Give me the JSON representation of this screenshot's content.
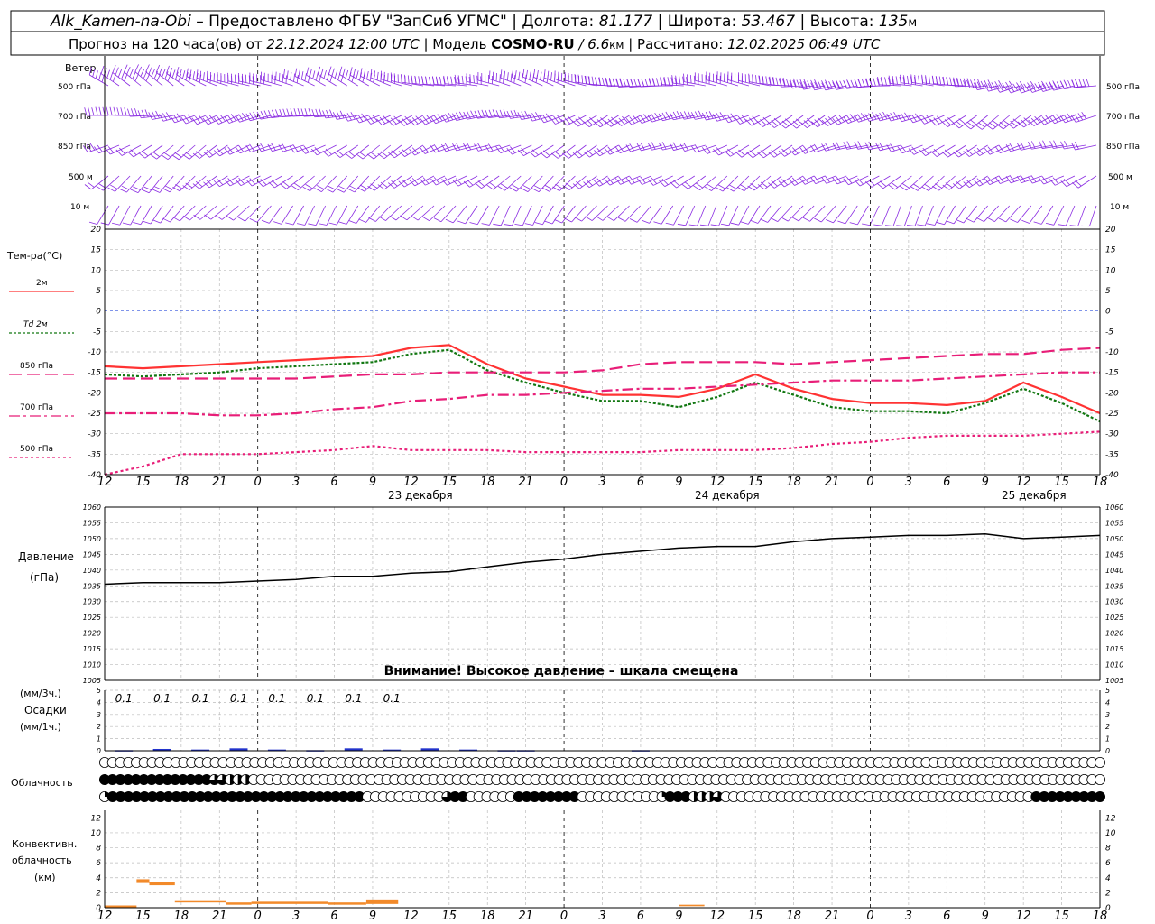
{
  "header": {
    "line1": {
      "station": "Alk_Kamen-na-Obi",
      "provider": " – Предоставлено ФГБУ \"ЗапСиб УГМС\" | Долгота: ",
      "lon": "81.177",
      "lat_label": " | Широта: ",
      "lat": "53.467",
      "alt_label": " | Высота: ",
      "alt": "135",
      "alt_unit": "м"
    },
    "line2": {
      "forecast": "Прогноз на 120 часа(ов) от ",
      "init": "22.12.2024 12:00 UTC",
      "model_label": "  | Модель ",
      "model": "COSMO-RU",
      "res": " / 6.6",
      "res_unit": "км",
      "calc_label": " | Рассчитано: ",
      "calc": "12.02.2025 06:49 UTC"
    }
  },
  "wind_panel": {
    "label": "Ветер",
    "levels": [
      "500 гПа",
      "700 гПа",
      "850 гПа",
      "500 м",
      "10  м"
    ],
    "color": "#8a2be2"
  },
  "temp_panel": {
    "label": "Тем-ра(°C)",
    "legend": [
      {
        "label": "2м",
        "color": "#ff3333",
        "dash": ""
      },
      {
        "label": "Td  2м",
        "color": "#117711",
        "dash": "3,2"
      },
      {
        "label": "850 гПа",
        "color": "#e81e78",
        "dash": "14,6"
      },
      {
        "label": "700 гПа",
        "color": "#e81e78",
        "dash": "12,4,3,4"
      },
      {
        "label": "500 гПа",
        "color": "#e81e78",
        "dash": "3,3"
      }
    ],
    "ticks": [
      20,
      15,
      10,
      5,
      0,
      -5,
      -10,
      -15,
      -20,
      -25,
      -30,
      -35,
      -40
    ]
  },
  "time_axis": {
    "hours": [
      "12",
      "15",
      "18",
      "21",
      "0",
      "3",
      "6",
      "9",
      "12",
      "15",
      "18",
      "21",
      "0",
      "3",
      "6",
      "9",
      "12",
      "15",
      "18",
      "21",
      "0",
      "3",
      "6",
      "9",
      "12",
      "15",
      "18"
    ],
    "days": [
      "23 декабря",
      "24 декабря",
      "25 декабря"
    ]
  },
  "pressure_panel": {
    "label1": "Давление",
    "label2": "(гПа)",
    "ticks": [
      1060,
      1055,
      1050,
      1045,
      1040,
      1035,
      1030,
      1025,
      1020,
      1015,
      1010,
      1005
    ],
    "warning": "Внимание! Высокое давление – шкала смещена"
  },
  "precip_panel": {
    "label1": "(мм/3ч.)",
    "label2": "Осадки",
    "label3": "(мм/1ч.)",
    "ticks": [
      5,
      4,
      3,
      2,
      1,
      0
    ],
    "amounts": [
      "0.1",
      "0.1",
      "0.1",
      "0.1",
      "0.1",
      "0.1",
      "0.1",
      "0.1"
    ]
  },
  "cloud_panel": {
    "label": "Облачность"
  },
  "conv_panel": {
    "label1": "Конвективн.",
    "label2": "облачность",
    "label3": "(км)",
    "ticks": [
      12,
      10,
      8,
      6,
      4,
      2,
      0
    ]
  },
  "chart_data": [
    {
      "type": "line",
      "title": "Тем-ра(°C)",
      "x_hours": [
        0,
        3,
        6,
        9,
        12,
        15,
        18,
        21,
        24,
        27,
        30,
        33,
        36,
        39,
        42,
        45,
        48,
        51,
        54,
        57,
        60,
        63,
        66,
        69,
        72,
        75,
        78
      ],
      "ylim": [
        -40,
        20
      ],
      "series": [
        {
          "name": "2м",
          "values": [
            -13.5,
            -14,
            -13.5,
            -13,
            -12.5,
            -12,
            -11.5,
            -11,
            -9,
            -8.3,
            -13,
            -16.5,
            -18.5,
            -20.5,
            -20.5,
            -21,
            -19,
            -15.5,
            -19,
            -21.5,
            -22.5,
            -22.5,
            -23,
            -22,
            -17.5,
            -21,
            -25
          ]
        },
        {
          "name": "Td  2м",
          "values": [
            -15.5,
            -16,
            -15.5,
            -15,
            -14,
            -13.5,
            -13,
            -12.5,
            -10.5,
            -9.5,
            -14.5,
            -17.5,
            -20,
            -22,
            -22,
            -23.5,
            -21,
            -17.5,
            -20.5,
            -23.5,
            -24.5,
            -24.5,
            -25,
            -22.5,
            -19,
            -22.5,
            -27
          ]
        },
        {
          "name": "850 гПа",
          "values": [
            -16.5,
            -16.5,
            -16.5,
            -16.5,
            -16.5,
            -16.5,
            -16,
            -15.5,
            -15.5,
            -15,
            -15,
            -15,
            -15,
            -14.5,
            -13,
            -12.5,
            -12.5,
            -12.5,
            -13,
            -12.5,
            -12,
            -11.5,
            -11,
            -10.5,
            -10.5,
            -9.5,
            -9
          ]
        },
        {
          "name": "700 гПа",
          "values": [
            -25,
            -25,
            -25,
            -25.5,
            -25.5,
            -25,
            -24,
            -23.5,
            -22,
            -21.5,
            -20.5,
            -20.5,
            -20,
            -19.5,
            -19,
            -19,
            -18.5,
            -18,
            -17.5,
            -17,
            -17,
            -17,
            -16.5,
            -16,
            -15.5,
            -15,
            -15
          ]
        },
        {
          "name": "500 гПа",
          "values": [
            -40,
            -38,
            -35,
            -35,
            -35,
            -34.5,
            -34,
            -33,
            -34,
            -34,
            -34,
            -34.5,
            -34.5,
            -34.5,
            -34.5,
            -34,
            -34,
            -34,
            -33.5,
            -32.5,
            -32,
            -31,
            -30.5,
            -30.5,
            -30.5,
            -30,
            -29.5
          ]
        }
      ]
    },
    {
      "type": "line",
      "title": "Давление",
      "x_hours": [
        0,
        3,
        6,
        9,
        12,
        15,
        18,
        21,
        24,
        27,
        30,
        33,
        36,
        39,
        42,
        45,
        48,
        51,
        54,
        57,
        60,
        63,
        66,
        69,
        72,
        75,
        78
      ],
      "ylim": [
        1005,
        1060
      ],
      "series": [
        {
          "name": "Давление",
          "values": [
            1035.5,
            1036,
            1036,
            1036,
            1036.5,
            1037,
            1038,
            1038,
            1039,
            1039.5,
            1041,
            1042.5,
            1043.5,
            1045,
            1046,
            1047,
            1047.5,
            1047.5,
            1049,
            1050,
            1050.5,
            1051,
            1051,
            1051.5,
            1050,
            1050.5,
            1051
          ]
        }
      ]
    },
    {
      "type": "bar",
      "title": "Осадки",
      "x_hours": [
        1.5,
        4.5,
        7.5,
        10.5,
        13.5,
        16.5,
        19.5,
        22.5,
        25.5,
        28.5,
        31.5,
        33,
        42
      ],
      "values": [
        0.05,
        0.15,
        0.1,
        0.2,
        0.1,
        0.05,
        0.2,
        0.1,
        0.2,
        0.1,
        0.05,
        0.05,
        0.05
      ],
      "ylim": [
        0,
        5
      ]
    },
    {
      "type": "table",
      "title": "Облачность",
      "rows": [
        "ooooooooooooooooooooooooooooooooooooooooooooooooooooooooooooooooooooooooooooooooooooooooooooooooooooooooooooooooooooooooooooooo",
        "FFFFFFFFFFFFFFMMHHHooooooooooooooooooooooooooooooooooooooooooooooooooooooooooooooooooooooooooooooooooooooooooooooooooooooooooooo",
        "QFFFFFFFFFFFFFFFFFFFFFFFFFFFFFFFFooooooooooMFFooooooFFFFFFFFooooooooooQFFFHHHMoooooooooooooooooooooooooooooooooooooooFFFFFFFFF"
      ]
    },
    {
      "type": "bar",
      "title": "Конвективн. облачность",
      "segments": [
        {
          "start": 0,
          "end": 2.5,
          "bottom": 0,
          "top": 0.3
        },
        {
          "start": 2.5,
          "end": 3.5,
          "bottom": 3.3,
          "top": 3.8
        },
        {
          "start": 3.5,
          "end": 5.5,
          "bottom": 3,
          "top": 3.4
        },
        {
          "start": 5.5,
          "end": 9.5,
          "bottom": 0.7,
          "top": 1
        },
        {
          "start": 9.5,
          "end": 11.5,
          "bottom": 0.4,
          "top": 0.7
        },
        {
          "start": 11.5,
          "end": 17.5,
          "bottom": 0.5,
          "top": 0.8
        },
        {
          "start": 17.5,
          "end": 20.5,
          "bottom": 0.4,
          "top": 0.7
        },
        {
          "start": 20.5,
          "end": 23,
          "bottom": 0.5,
          "top": 1.1
        },
        {
          "start": 45,
          "end": 47,
          "bottom": 0.2,
          "top": 0.4
        }
      ],
      "ylim": [
        0,
        13
      ]
    }
  ]
}
